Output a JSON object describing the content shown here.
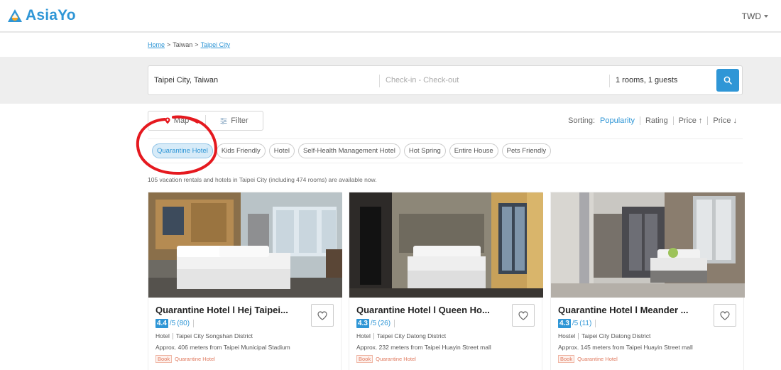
{
  "header": {
    "brand": "AsiaYo",
    "currency": "TWD",
    "colors": {
      "accent": "#2f96d6",
      "logo_orange": "#f5a623",
      "annotation": "#e5191f"
    }
  },
  "breadcrumb": {
    "home": "Home",
    "sep1": ">",
    "country": "Taiwan",
    "sep2": ">",
    "city": "Taipei City"
  },
  "search": {
    "destination": "Taipei City, Taiwan",
    "dates_placeholder": "Check-in - Check-out",
    "guests": "1 rooms, 1 guests",
    "search_icon": "search-icon"
  },
  "controls": {
    "map_label": "Map",
    "filter_label": "Filter"
  },
  "sorting": {
    "label": "Sorting:",
    "options": [
      "Popularity",
      "Rating",
      "Price ↑",
      "Price ↓"
    ],
    "active": "Popularity"
  },
  "tags": [
    "Quarantine Hotel",
    "Kids Friendly",
    "Hotel",
    "Self-Health Management Hotel",
    "Hot Spring",
    "Entire House",
    "Pets Friendly"
  ],
  "active_tag": "Quarantine Hotel",
  "results_text": "105 vacation rentals and hotels in Taipei City (including 474 rooms) are available now.",
  "cards": [
    {
      "title": "Quarantine Hotel l Hej Taipei...",
      "score": "4.4",
      "out_of": "/5",
      "reviews": "(80)",
      "type": "Hotel",
      "district": "Taipei City Songshan District",
      "distance": "Approx. 406 meters from Taipei Municipal Stadium",
      "badge_book": "Book",
      "badge_tag": "Quarantine Hotel"
    },
    {
      "title": "Quarantine Hotel l Queen Ho...",
      "score": "4.3",
      "out_of": "/5",
      "reviews": "(26)",
      "type": "Hotel",
      "district": "Taipei City Datong District",
      "distance": "Approx. 232 meters from Taipei Huayin Street mall",
      "badge_book": "Book",
      "badge_tag": "Quarantine Hotel"
    },
    {
      "title": "Quarantine Hotel l Meander ...",
      "score": "4.3",
      "out_of": "/5",
      "reviews": "(11)",
      "type": "Hostel",
      "district": "Taipei City Datong District",
      "distance": "Approx. 145 meters from Taipei Huayin Street mall",
      "badge_book": "Book",
      "badge_tag": "Quarantine Hotel"
    }
  ]
}
